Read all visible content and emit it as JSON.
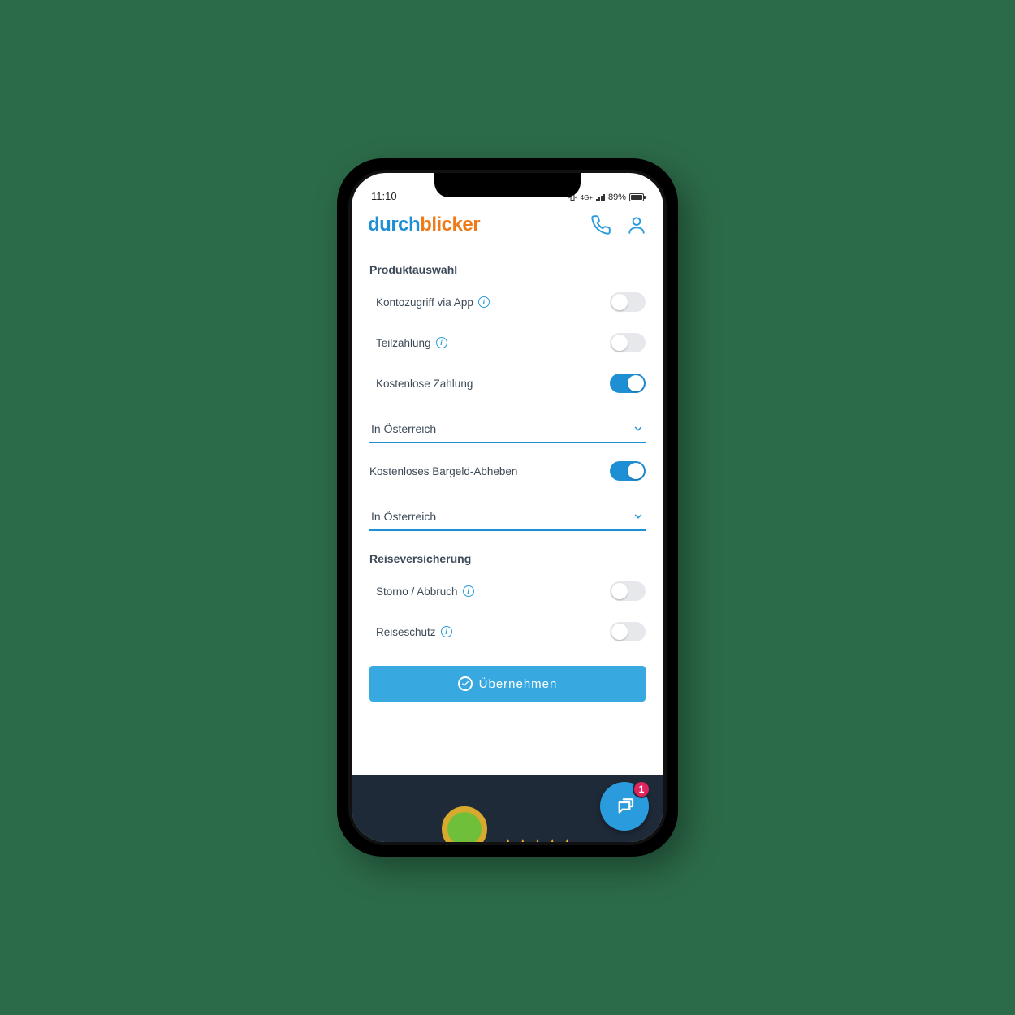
{
  "status": {
    "time": "11:10",
    "network_label": "4G+",
    "battery_text": "89%"
  },
  "brand": {
    "part1": "durch",
    "part2": "blicker"
  },
  "sections": {
    "product": {
      "title": "Produktauswahl",
      "items": [
        {
          "label": "Kontozugriff via App",
          "has_info": true,
          "on": false
        },
        {
          "label": "Teilzahlung",
          "has_info": true,
          "on": false
        },
        {
          "label": "Kostenlose Zahlung",
          "has_info": false,
          "on": true
        }
      ]
    },
    "dropdown1": {
      "label": "In Österreich"
    },
    "cash": {
      "label": "Kostenloses Bargeld-Abheben",
      "on": true
    },
    "dropdown2": {
      "label": "In Österreich"
    },
    "travel": {
      "title": "Reiseversicherung",
      "items": [
        {
          "label": "Storno / Abbruch",
          "has_info": true,
          "on": false
        },
        {
          "label": "Reiseschutz",
          "has_info": true,
          "on": false
        }
      ]
    }
  },
  "apply_button": "Übernehmen",
  "chat": {
    "badge": "1"
  },
  "info_glyph": "i"
}
